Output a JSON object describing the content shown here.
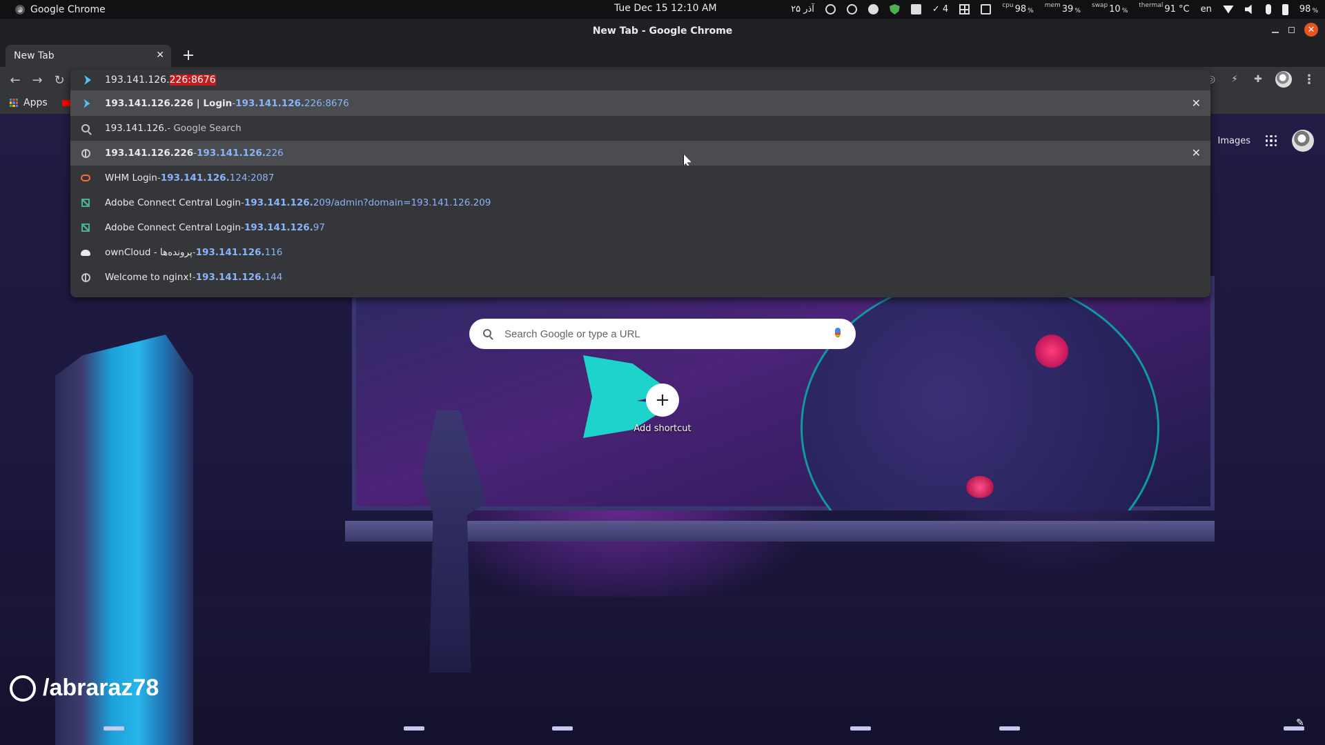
{
  "system_bar": {
    "app_name": "Google Chrome",
    "clock": "Tue Dec 15  12:10 AM",
    "persian_date": "۲۵ آذر",
    "check_count": "4",
    "cpu_label": "cpu",
    "cpu_value": "98",
    "mem_label": "mem",
    "mem_value": "39",
    "swap_label": "swap",
    "swap_value": "10",
    "thermal_label": "thermal",
    "thermal_value": "91 °C",
    "language": "en",
    "battery": "98"
  },
  "window": {
    "title": "New Tab - Google Chrome"
  },
  "tabs": [
    {
      "label": "New Tab"
    }
  ],
  "bookmarks": {
    "apps_label": "Apps"
  },
  "omnibox": {
    "typed": "193.141.126.",
    "autocomplete": "226:8676",
    "suggestions": [
      {
        "title_bold": "193.141.126.226 | Login",
        "sep": " - ",
        "url_bold": "193.141.126.",
        "url_rest": "226:8676",
        "icon": "lightning-icon",
        "removable": true
      },
      {
        "text": "193.141.126.",
        "suffix": " - Google Search",
        "icon": "search-icon"
      },
      {
        "title_bold": "193.141.126.226",
        "sep": " - ",
        "url_bold": "193.141.126.",
        "url_rest": "226",
        "icon": "globe-icon",
        "removable": true
      },
      {
        "title": "WHM Login",
        "sep": " - ",
        "url_bold": "193.141.126.",
        "url_rest": "124:2087",
        "icon": "cpanel-icon"
      },
      {
        "title": "Adobe Connect Central Login",
        "sep": " - ",
        "url_bold": "193.141.126.",
        "url_rest": "209/admin?domain=193.141.126.209",
        "icon": "adobe-connect-icon"
      },
      {
        "title": "Adobe Connect Central Login",
        "sep": " - ",
        "url_bold": "193.141.126.",
        "url_rest": "97",
        "icon": "adobe-connect-icon"
      },
      {
        "title": "ownCloud - پرونده‌ها",
        "sep": " - ",
        "url_bold": "193.141.126.",
        "url_rest": "116",
        "icon": "cloud-icon"
      },
      {
        "title": "Welcome to nginx!",
        "sep": " - ",
        "url_bold": "193.141.126.",
        "url_rest": "144",
        "icon": "globe-icon"
      }
    ]
  },
  "ntp": {
    "images_link": "Images",
    "search_placeholder": "Search Google or type a URL",
    "add_shortcut_label": "Add shortcut"
  },
  "watermark": "/abraraz78",
  "colors": {
    "autocomplete_highlight": "#c41c1c",
    "url": "#8ab4f8"
  }
}
